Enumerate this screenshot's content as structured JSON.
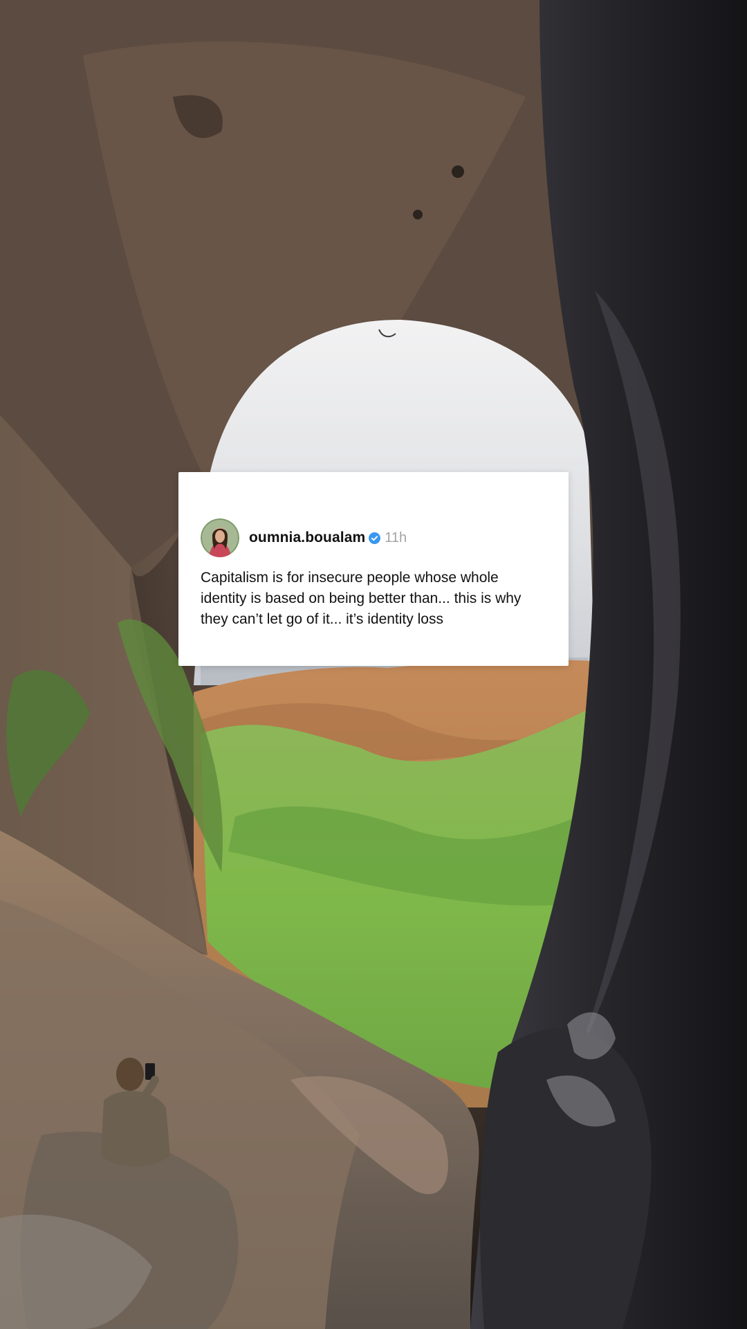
{
  "post": {
    "username": "oumnia.boualam",
    "timestamp": "11h",
    "text": "Capitalism is for insecure people whose whole identity is based on being better than... this is why they can’t let go of it... it’s identity loss",
    "verified": true
  },
  "background": {
    "description_icons": [
      "cave-arch",
      "valley",
      "person-with-phone"
    ]
  },
  "colors": {
    "card_bg": "#ffffff",
    "verified": "#3897f0",
    "timestamp": "#a3a3a3",
    "text": "#111111"
  }
}
